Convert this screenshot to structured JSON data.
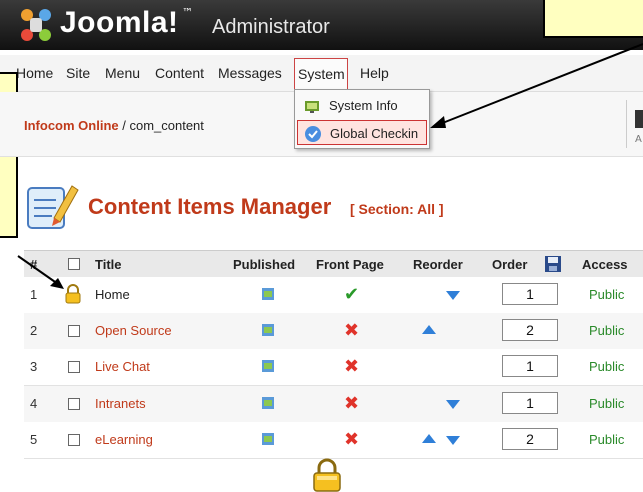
{
  "header": {
    "logo_text": "Joomla!",
    "logo_tm": "™",
    "subtitle": "Administrator"
  },
  "menu": [
    "Home",
    "Site",
    "Menu",
    "Content",
    "Messages",
    "System",
    "Help"
  ],
  "breadcrumb": {
    "site": "Infocom Online",
    "separator": " / ",
    "path": "com_content"
  },
  "dropdown": {
    "items": [
      {
        "label": "System Info",
        "icon": "system-info-icon"
      },
      {
        "label": "Global Checkin",
        "icon": "global-checkin-icon",
        "selected": true
      }
    ]
  },
  "page": {
    "title": "Content Items Manager",
    "section": "[ Section: All ]"
  },
  "table": {
    "headers": {
      "num": "#",
      "title": "Title",
      "published": "Published",
      "frontpage": "Front Page",
      "reorder": "Reorder",
      "order": "Order",
      "access": "Access"
    },
    "rows": [
      {
        "num": "1",
        "title": "Home",
        "locked": true,
        "front": "✔",
        "front_state": "yes",
        "up": false,
        "down": true,
        "order": "1",
        "access": "Public"
      },
      {
        "num": "2",
        "title": "Open Source",
        "locked": false,
        "front": "✖",
        "front_state": "no",
        "up": true,
        "down": false,
        "order": "2",
        "access": "Public"
      },
      {
        "num": "3",
        "title": "Live Chat",
        "locked": false,
        "front": "✖",
        "front_state": "no",
        "up": false,
        "down": false,
        "order": "1",
        "access": "Public"
      },
      {
        "num": "4",
        "title": "Intranets",
        "locked": false,
        "front": "✖",
        "front_state": "no",
        "up": false,
        "down": true,
        "order": "1",
        "access": "Public"
      },
      {
        "num": "5",
        "title": "eLearning",
        "locked": false,
        "front": "✖",
        "front_state": "no",
        "up": true,
        "down": true,
        "order": "2",
        "access": "Public"
      }
    ]
  },
  "colors": {
    "accent": "#c03a1a",
    "access": "#2a8a2a",
    "callout": "#ffffc0",
    "arrow": "#2f7fd8"
  }
}
